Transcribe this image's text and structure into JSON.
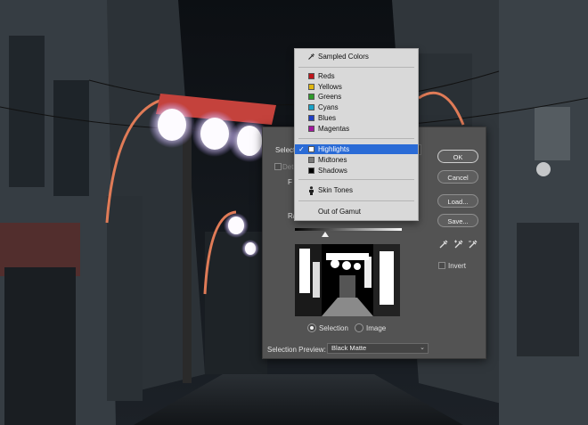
{
  "dialog": {
    "select_label": "Select",
    "detect_label": "Dete",
    "fuzziness_label": "F",
    "range_label": "Rang",
    "buttons": {
      "ok": "OK",
      "cancel": "Cancel",
      "load": "Load...",
      "save": "Save..."
    },
    "invert_label": "Invert",
    "view_options": {
      "selection": "Selection",
      "image": "Image",
      "selected": "Selection"
    },
    "selection_preview": {
      "label": "Selection Preview:",
      "value": "Black Matte"
    },
    "eyedroppers": [
      "eyedropper-icon",
      "eyedropper-plus-icon",
      "eyedropper-minus-icon"
    ]
  },
  "menu": {
    "sampled": {
      "label": "Sampled Colors",
      "icon": "eyedropper-icon"
    },
    "colors": [
      {
        "label": "Reds",
        "color": "#c0151b"
      },
      {
        "label": "Yellows",
        "color": "#e0b60f"
      },
      {
        "label": "Greens",
        "color": "#2e9a2a"
      },
      {
        "label": "Cyans",
        "color": "#1aa2c8"
      },
      {
        "label": "Blues",
        "color": "#1f3fc4"
      },
      {
        "label": "Magentas",
        "color": "#a2189e"
      }
    ],
    "tones": [
      {
        "label": "Highlights",
        "color": "#ffffff",
        "selected": true
      },
      {
        "label": "Midtones",
        "color": "#7a7a7a",
        "selected": false
      },
      {
        "label": "Shadows",
        "color": "#000000",
        "selected": false
      }
    ],
    "skin": {
      "label": "Skin Tones",
      "icon": "person-icon"
    },
    "gamut": {
      "label": "Out of Gamut"
    },
    "checkmark": "✓"
  }
}
